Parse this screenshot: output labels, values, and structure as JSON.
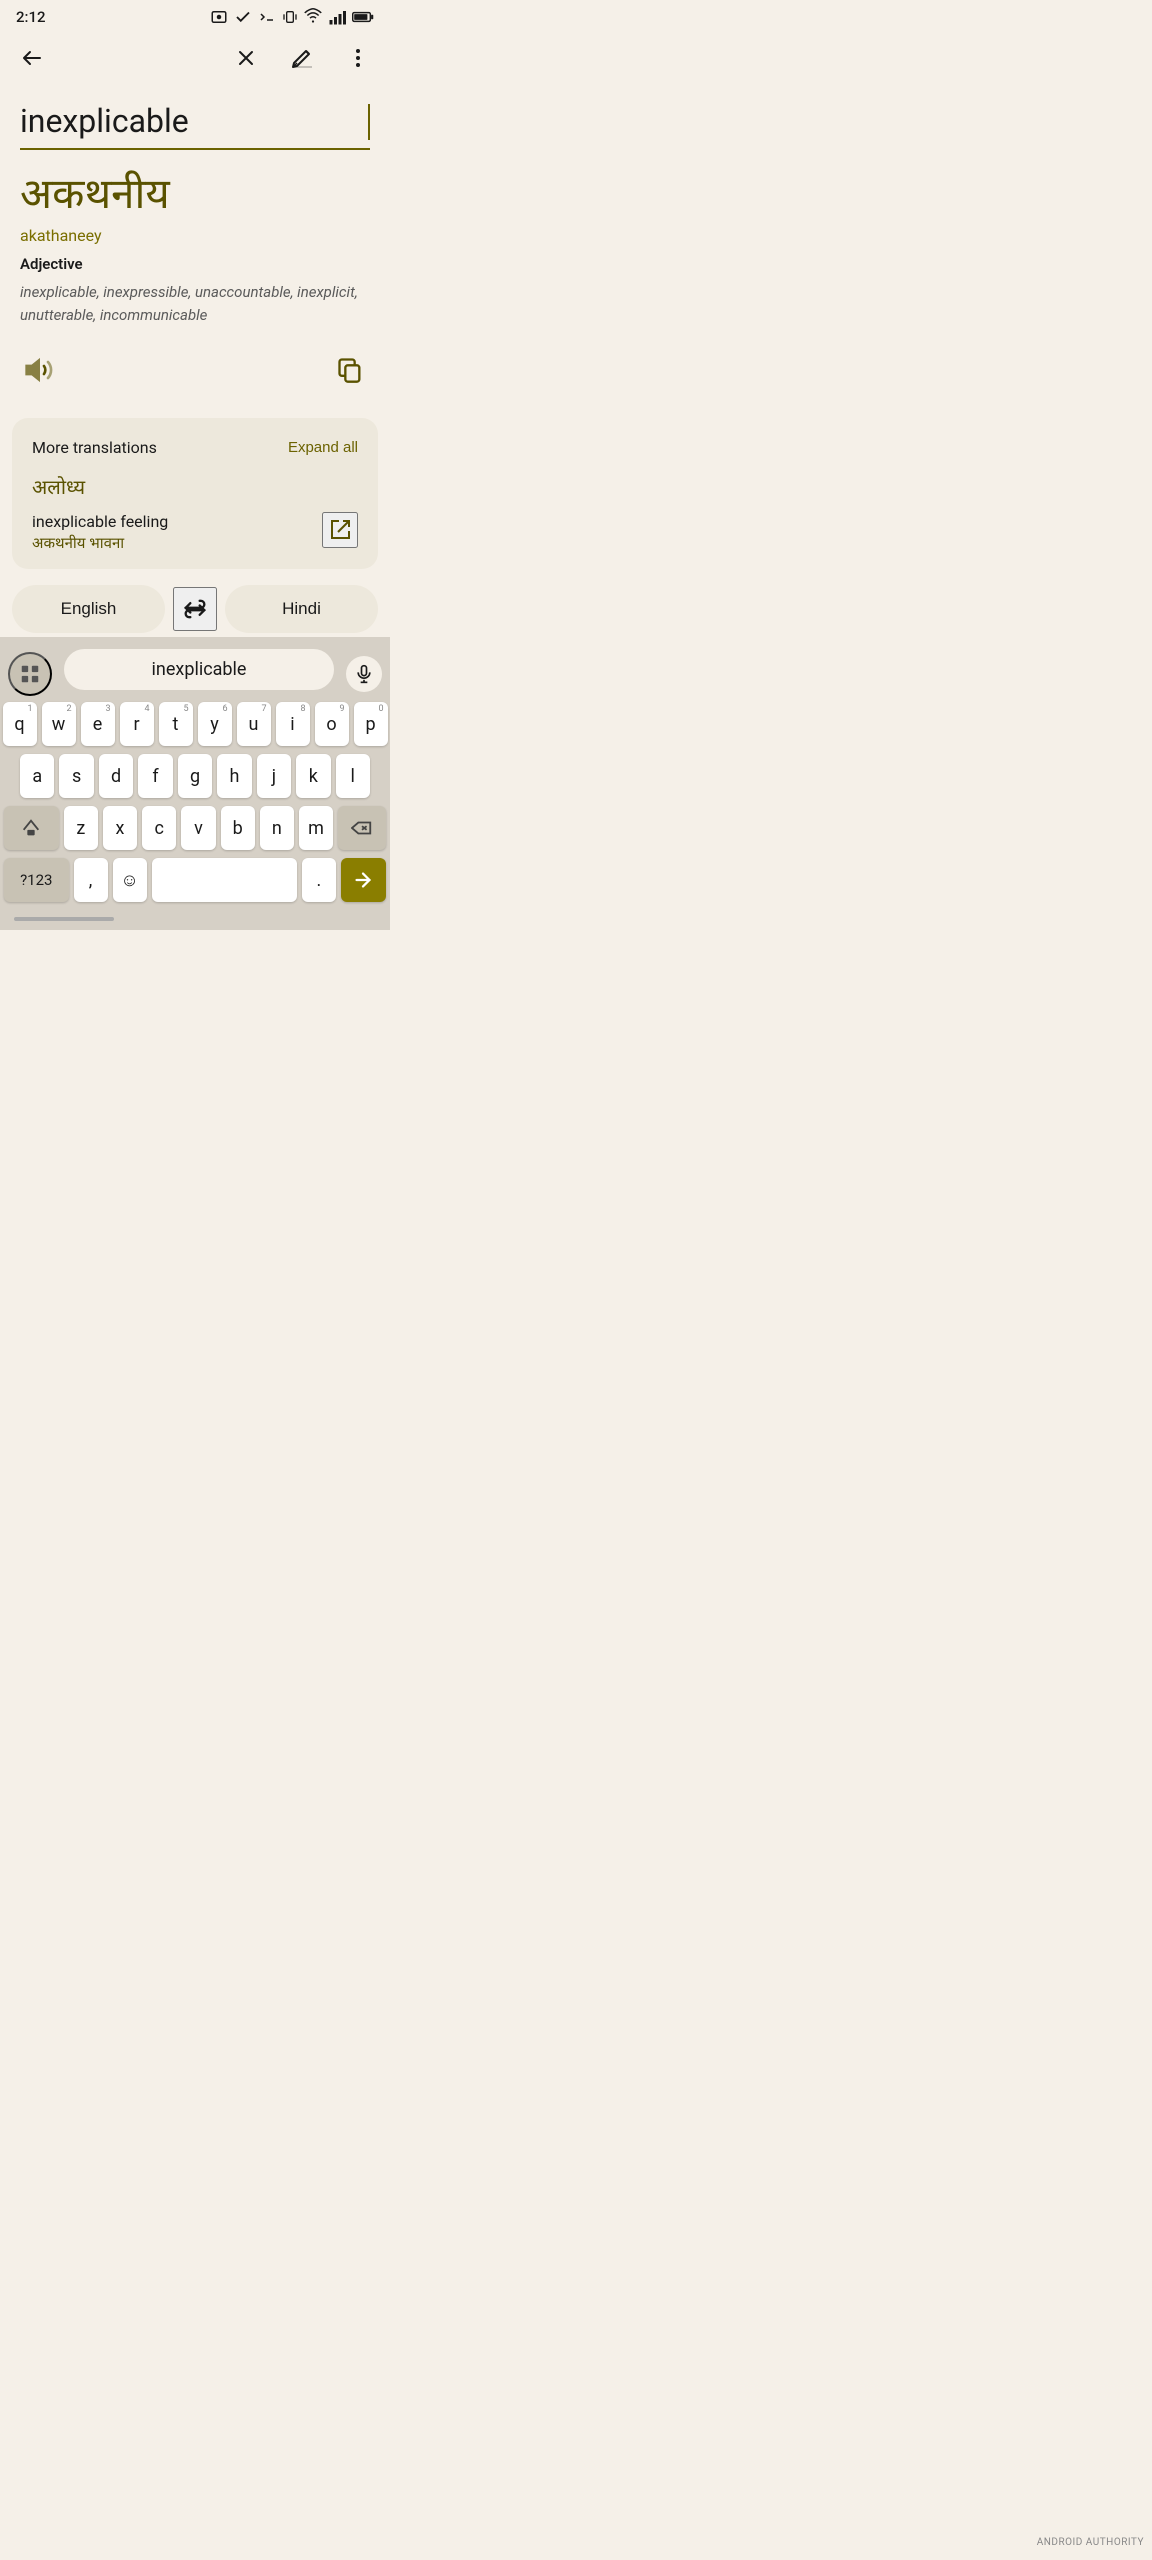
{
  "statusBar": {
    "time": "2:12",
    "icons": [
      "photo",
      "check",
      "terminal",
      "vibrate",
      "wifi",
      "signal",
      "battery"
    ]
  },
  "actionBar": {
    "backLabel": "back",
    "clearLabel": "clear",
    "editLabel": "edit",
    "moreLabel": "more"
  },
  "sourceText": "inexplicable",
  "translation": {
    "hindi": "अकथनीय",
    "transliteration": "akathaneey",
    "pos": "Adjective",
    "synonyms": "inexplicable, inexpressible, unaccountable, inexplicit, unutterable, incommunicable"
  },
  "moreTranslations": {
    "title": "More translations",
    "expandAll": "Expand all",
    "firstHindi": "अलोध्य",
    "phrase": {
      "english": "inexplicable feeling",
      "hindi": "अकथनीय भावना"
    }
  },
  "langSwitcher": {
    "source": "English",
    "target": "Hindi"
  },
  "keyboard": {
    "searchText": "inexplicable",
    "rows": [
      [
        "q",
        "w",
        "e",
        "r",
        "t",
        "y",
        "u",
        "i",
        "o",
        "p"
      ],
      [
        "a",
        "s",
        "d",
        "f",
        "g",
        "h",
        "j",
        "k",
        "l"
      ],
      [
        "z",
        "x",
        "c",
        "v",
        "b",
        "n",
        "m"
      ],
      [
        "?123",
        ",",
        "☺",
        "",
        ".",
        ">"
      ]
    ],
    "numHints": [
      "1",
      "2",
      "3",
      "4",
      "5",
      "6",
      "7",
      "8",
      "9",
      "0"
    ]
  },
  "colors": {
    "brand": "#6b6200",
    "bg": "#f5f0e8",
    "cardBg": "#ede8dc",
    "keyBg": "#ffffff",
    "specialKeyBg": "#c8c2b4",
    "actionKeyBg": "#8a7e00",
    "keyboardBg": "#d6d0c6"
  }
}
